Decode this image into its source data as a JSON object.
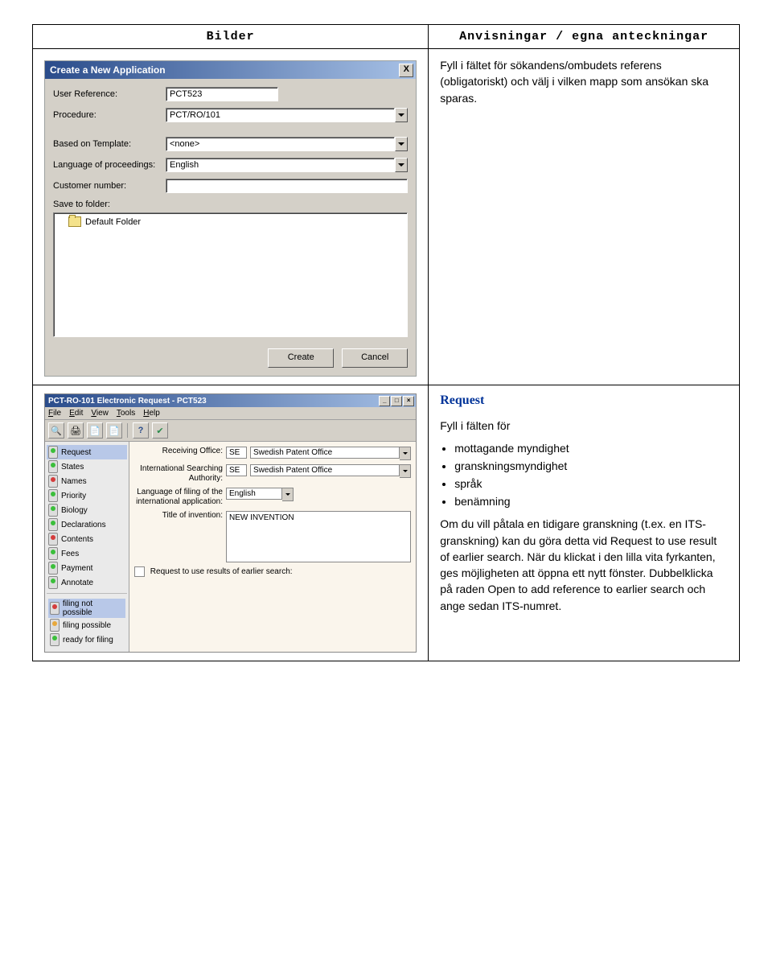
{
  "headers": {
    "left": "Bilder",
    "right": "Anvisningar / egna anteckningar"
  },
  "cell1_text": "Fyll i fältet för sökandens/ombudets referens (obligatoriskt) och välj i vilken mapp som ansökan ska sparas.",
  "dialog1": {
    "title": "Create a New Application",
    "close_label": "X",
    "labels": {
      "user_ref": "User Reference:",
      "procedure": "Procedure:",
      "template": "Based on Template:",
      "lang": "Language of proceedings:",
      "cust": "Customer number:",
      "save": "Save to folder:"
    },
    "values": {
      "user_ref": "PCT523",
      "procedure": "PCT/RO/101",
      "template": "<none>",
      "lang": "English",
      "cust": ""
    },
    "folder_item": "Default Folder",
    "buttons": {
      "create": "Create",
      "cancel": "Cancel"
    }
  },
  "appwin": {
    "title": "PCT-RO-101 Electronic Request - PCT523",
    "menu": [
      "File",
      "Edit",
      "View",
      "Tools",
      "Help"
    ],
    "nav": [
      "Request",
      "States",
      "Names",
      "Priority",
      "Biology",
      "Declarations",
      "Contents",
      "Fees",
      "Payment",
      "Annotate"
    ],
    "legend": {
      "red": "filing not possible",
      "orange": "filing possible",
      "green": "ready for filing"
    },
    "form": {
      "recv_label": "Receiving Office:",
      "recv_code": "SE",
      "recv_name": "Swedish Patent Office",
      "isa_label": "International Searching Authority:",
      "isa_code": "SE",
      "isa_name": "Swedish Patent Office",
      "lang_label": "Language of filing of the international application:",
      "lang_value": "English",
      "title_label": "Title of invention:",
      "title_value": "NEW INVENTION",
      "earlier_label": "Request to use results of earlier search:"
    }
  },
  "cell2": {
    "heading": "Request",
    "intro": "Fyll i fälten för",
    "bullets": [
      "mottagande myndighet",
      "granskningsmyndighet",
      "språk",
      "benämning"
    ],
    "para": "Om du vill påtala en tidigare granskning (t.ex. en ITS-granskning) kan du göra detta vid Request to use result of earlier search. När du klickat i den lilla vita fyrkanten, ges möjligheten att öppna ett nytt fönster. Dubbelklicka på raden Open to add reference to earlier search och ange sedan ITS-numret."
  }
}
